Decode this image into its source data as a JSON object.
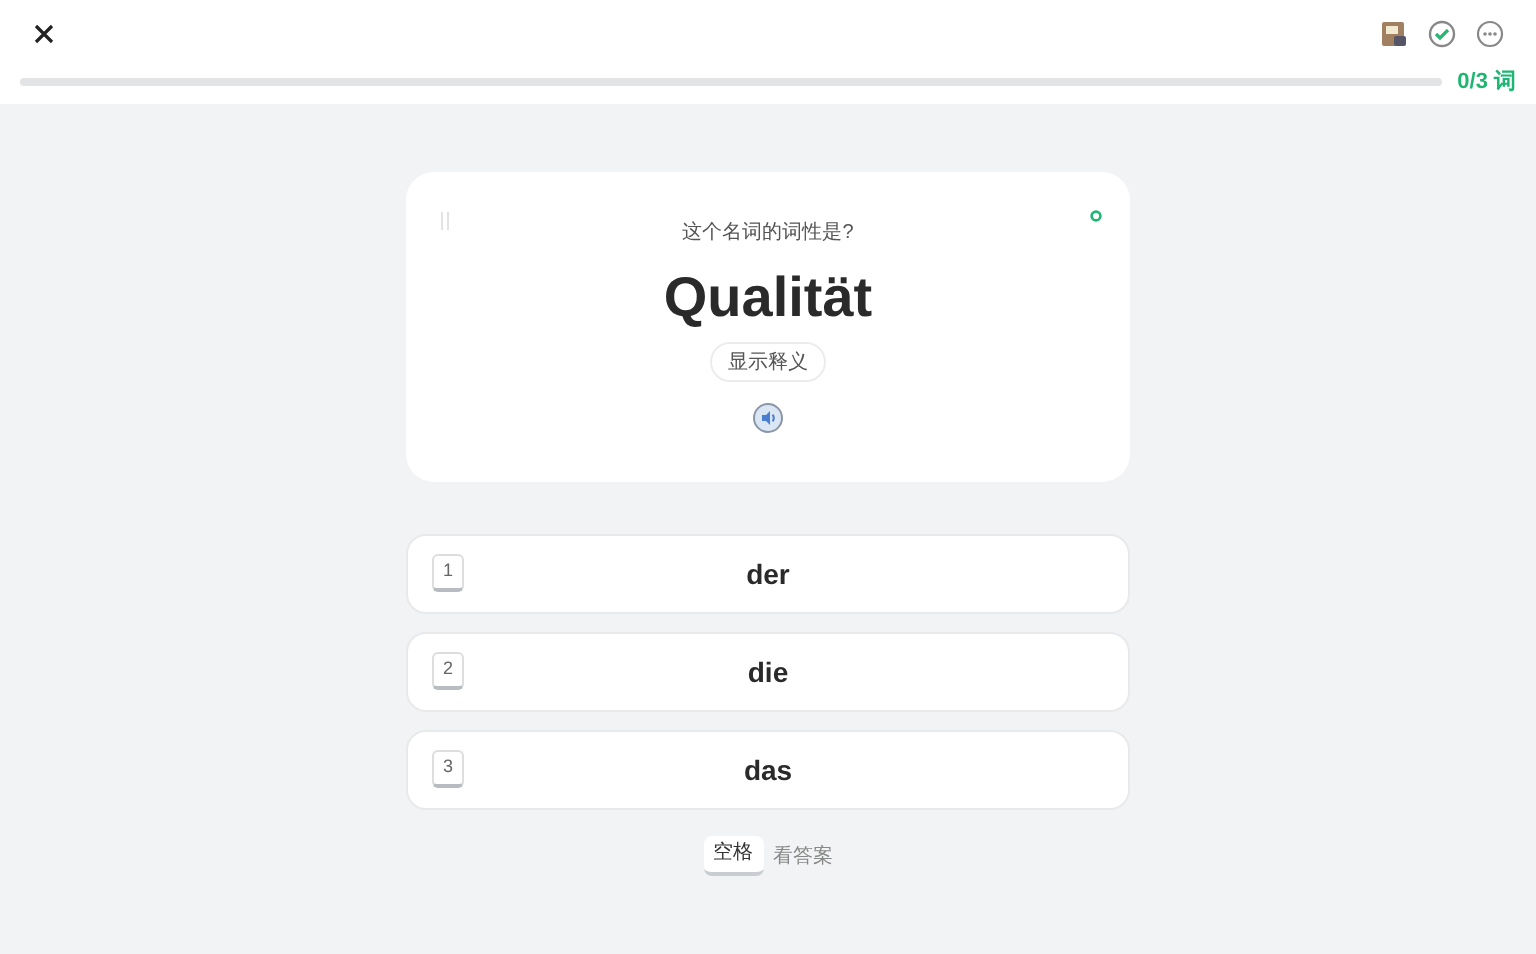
{
  "progress": {
    "level": 0,
    "reading": "0/3 词"
  },
  "card": {
    "prompt": "这个名词的词性是?",
    "word": "Qualität",
    "reveal_button": "显示释义"
  },
  "options": [
    {
      "key": "1",
      "label": "der"
    },
    {
      "key": "2",
      "label": "die"
    },
    {
      "key": "3",
      "label": "das"
    }
  ],
  "hint": {
    "key": "空格",
    "label": "看答案"
  }
}
